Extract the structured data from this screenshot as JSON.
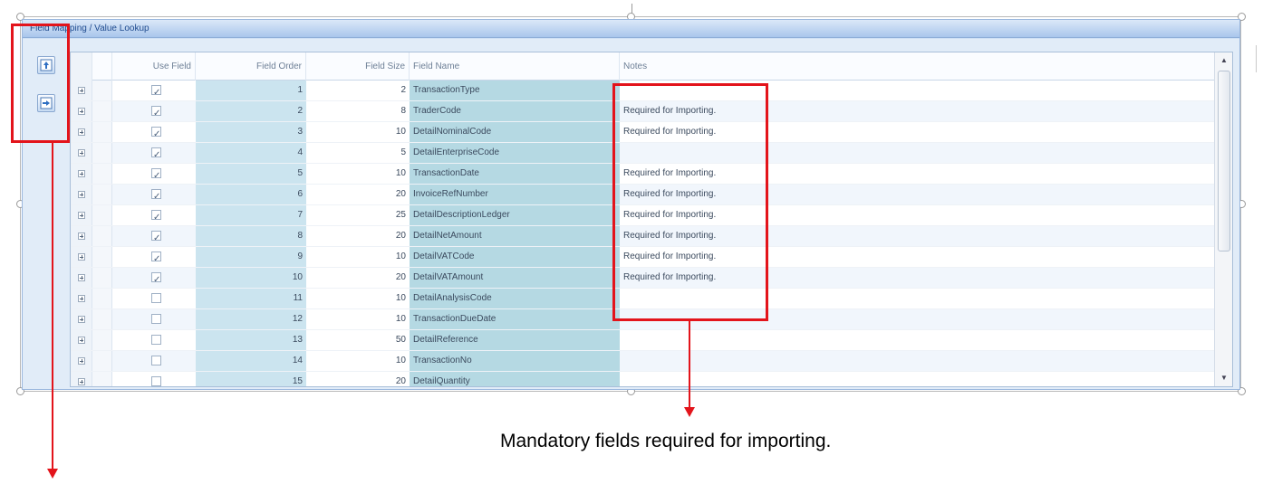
{
  "panel": {
    "title": "Field Mapping / Value Lookup"
  },
  "side_buttons": [
    {
      "icon": "import-up-icon"
    },
    {
      "icon": "import-right-icon"
    }
  ],
  "grid": {
    "columns": {
      "use_field": "Use Field",
      "field_order": "Field Order",
      "field_size": "Field Size",
      "field_name": "Field Name",
      "notes": "Notes"
    },
    "rows": [
      {
        "use": true,
        "order": "1",
        "size": "2",
        "name": "TransactionType",
        "notes": ""
      },
      {
        "use": true,
        "order": "2",
        "size": "8",
        "name": "TraderCode",
        "notes": "Required for Importing."
      },
      {
        "use": true,
        "order": "3",
        "size": "10",
        "name": "DetailNominalCode",
        "notes": "Required for Importing."
      },
      {
        "use": true,
        "order": "4",
        "size": "5",
        "name": "DetailEnterpriseCode",
        "notes": ""
      },
      {
        "use": true,
        "order": "5",
        "size": "10",
        "name": "TransactionDate",
        "notes": "Required for Importing."
      },
      {
        "use": true,
        "order": "6",
        "size": "20",
        "name": "InvoiceRefNumber",
        "notes": "Required for Importing."
      },
      {
        "use": true,
        "order": "7",
        "size": "25",
        "name": "DetailDescriptionLedger",
        "notes": "Required for Importing."
      },
      {
        "use": true,
        "order": "8",
        "size": "20",
        "name": "DetailNetAmount",
        "notes": "Required for Importing."
      },
      {
        "use": true,
        "order": "9",
        "size": "10",
        "name": "DetailVATCode",
        "notes": "Required for Importing."
      },
      {
        "use": true,
        "order": "10",
        "size": "20",
        "name": "DetailVATAmount",
        "notes": "Required for Importing."
      },
      {
        "use": false,
        "order": "11",
        "size": "10",
        "name": "DetailAnalysisCode",
        "notes": ""
      },
      {
        "use": false,
        "order": "12",
        "size": "10",
        "name": "TransactionDueDate",
        "notes": ""
      },
      {
        "use": false,
        "order": "13",
        "size": "50",
        "name": "DetailReference",
        "notes": ""
      },
      {
        "use": false,
        "order": "14",
        "size": "10",
        "name": "TransactionNo",
        "notes": ""
      },
      {
        "use": false,
        "order": "15",
        "size": "20",
        "name": "DetailQuantity",
        "notes": ""
      }
    ]
  },
  "annotation": {
    "caption": "Mandatory fields required for importing.",
    "color": "#e3141b"
  }
}
